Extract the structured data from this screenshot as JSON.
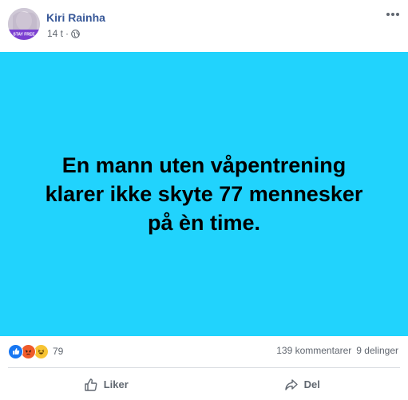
{
  "post": {
    "author": "Kiri Rainha",
    "timestamp": "14 t",
    "separator": "·",
    "privacy_icon": "globe-icon",
    "avatar_badge": "STAY FREE",
    "message": "En mann uten våpentrening klarer ikke skyte 77 mennesker på èn time.",
    "background_color": "#21d3fd"
  },
  "reactions": {
    "icons": [
      "like-icon",
      "angry-icon",
      "haha-icon"
    ],
    "count": "79"
  },
  "stats": {
    "comments": "139 kommentarer",
    "shares": "9 delinger"
  },
  "actions": {
    "like_label": "Liker",
    "share_label": "Del"
  }
}
